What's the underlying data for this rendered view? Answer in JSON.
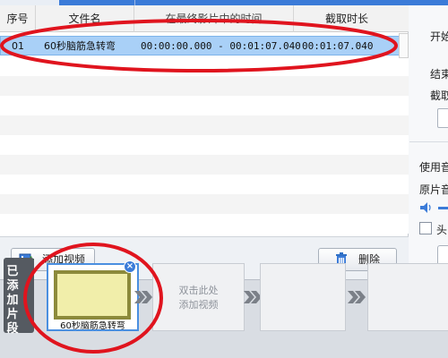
{
  "table": {
    "headers": {
      "index": "序号",
      "filename": "文件名",
      "range": "在最终影片中的时间",
      "duration": "截取时长"
    },
    "rows": [
      {
        "index": "01",
        "filename": "60秒脑筋急转弯",
        "range": "00:00:00.000 - 00:01:07.040",
        "duration": "00:01:07.040"
      }
    ]
  },
  "toolbar": {
    "add_video_label": "添加视频",
    "delete_label": "删除"
  },
  "right_panel": {
    "start_label": "开始",
    "end_label": "结束",
    "cut_label": "截取",
    "use_audio_label": "使用音",
    "original_audio_label": "原片音",
    "head_label": "头"
  },
  "bottom": {
    "side_label": "已添加片段",
    "clip_name": "60秒脑筋急转弯",
    "placeholder_line1": "双击此处",
    "placeholder_line2": "添加视频",
    "close_glyph": "×"
  },
  "colors": {
    "accent": "#3b7bd8",
    "selection": "#a9d0f7",
    "annotation": "#e0141e"
  }
}
